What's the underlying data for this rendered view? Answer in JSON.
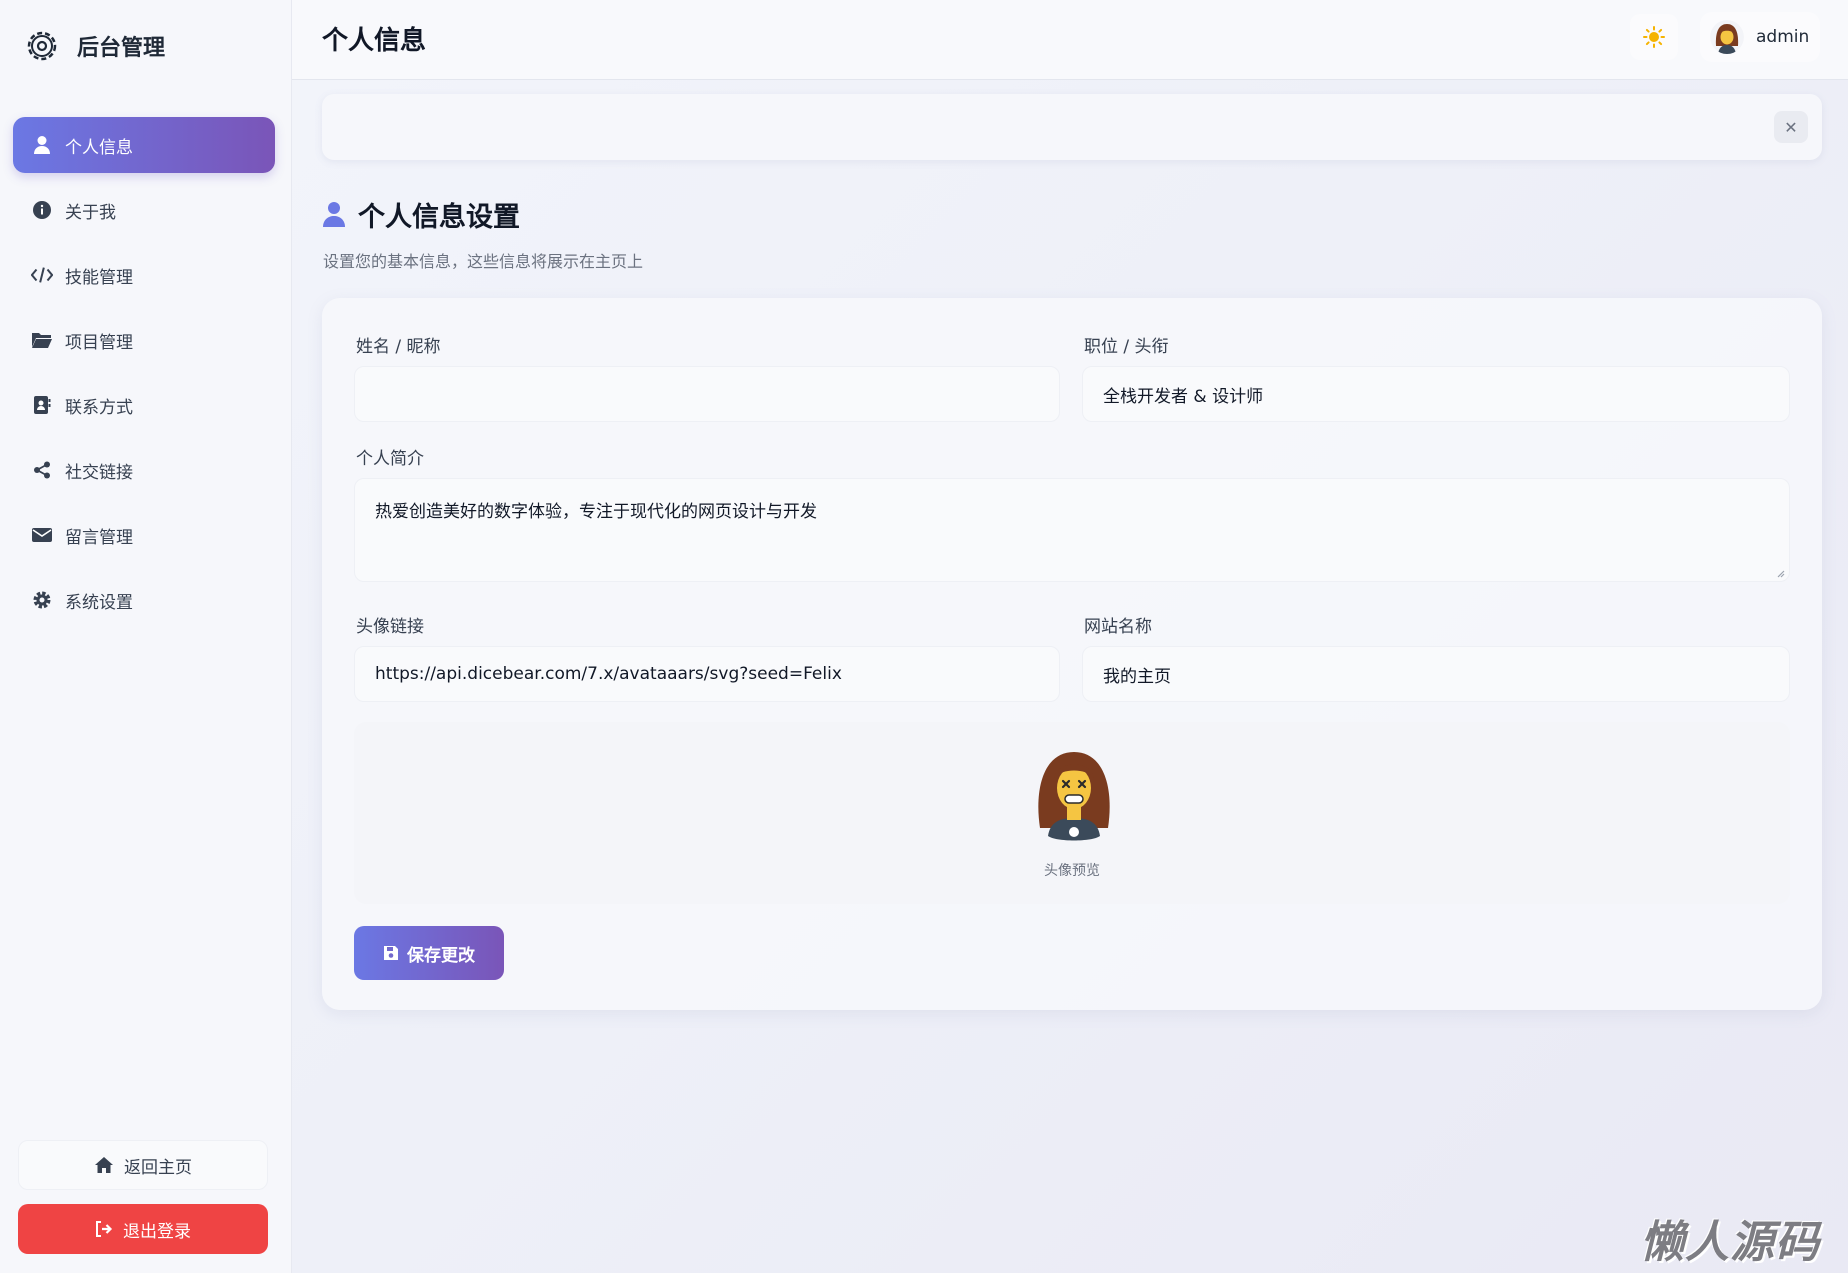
{
  "sidebar": {
    "brand_title": "后台管理",
    "items": [
      {
        "label": "个人信息",
        "icon": "user-icon",
        "active": true
      },
      {
        "label": "关于我",
        "icon": "info-icon"
      },
      {
        "label": "技能管理",
        "icon": "code-icon"
      },
      {
        "label": "项目管理",
        "icon": "folder-icon"
      },
      {
        "label": "联系方式",
        "icon": "contact-book-icon"
      },
      {
        "label": "社交链接",
        "icon": "share-icon"
      },
      {
        "label": "留言管理",
        "icon": "envelope-icon"
      },
      {
        "label": "系统设置",
        "icon": "gear-icon"
      }
    ],
    "home_label": "返回主页",
    "logout_label": "退出登录"
  },
  "header": {
    "title": "个人信息",
    "username": "admin"
  },
  "section": {
    "title": "个人信息设置",
    "subtitle": "设置您的基本信息，这些信息将展示在主页上"
  },
  "form": {
    "name_label": "姓名 / 昵称",
    "name_value": "",
    "position_label": "职位 / 头衔",
    "position_value": "全栈开发者 & 设计师",
    "bio_label": "个人简介",
    "bio_value": "热爱创造美好的数字体验，专注于现代化的网页设计与开发",
    "avatar_label": "头像链接",
    "avatar_value": "https://api.dicebear.com/7.x/avataaars/svg?seed=Felix",
    "site_label": "网站名称",
    "site_value": "我的主页",
    "preview_label": "头像预览",
    "save_label": "保存更改"
  },
  "watermark": "懒人源码",
  "colors": {
    "accent_start": "#6b78e4",
    "accent_end": "#7a55b8",
    "danger": "#ef4444",
    "sun": "#f5b301"
  }
}
